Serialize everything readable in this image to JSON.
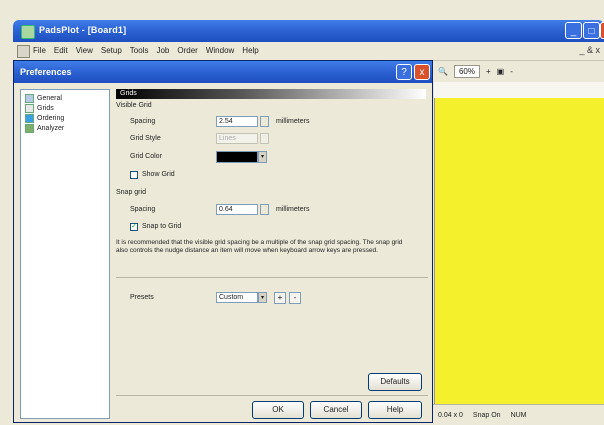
{
  "app": {
    "title": "PadsPlot - [Board1]",
    "menu": [
      "File",
      "Edit",
      "View",
      "Setup",
      "Tools",
      "Job",
      "Order",
      "Window",
      "Help"
    ],
    "mdi_controls": "_ & x",
    "window_buttons": {
      "minimize": "_",
      "maximize": "□",
      "close": "x"
    }
  },
  "toolbar": {
    "zoom": "60%",
    "plus": "+",
    "minus": "-"
  },
  "statusbar": {
    "coords": "0.04 x 0",
    "snap": "Snap On",
    "mode": "NUM"
  },
  "dialog": {
    "title": "Preferences",
    "help_button": "?",
    "close_button": "x",
    "nav_items": [
      {
        "label": "General",
        "icon": "general-icon"
      },
      {
        "label": "Grids",
        "icon": "grids-icon"
      },
      {
        "label": "Ordering",
        "icon": "ordering-icon"
      },
      {
        "label": "Analyzer",
        "icon": "analyzer-icon"
      }
    ],
    "panel_title": "Grids",
    "visible_grid": {
      "heading": "Visible Grid",
      "spacing_label": "Spacing",
      "spacing_value": "2.54",
      "units": "millimeters",
      "grid_style_label": "Grid Style",
      "grid_style_value": "Lines",
      "grid_color_label": "Grid Color",
      "grid_color": "#000000",
      "show_grid_label": "Show Grid",
      "show_grid_checked": false
    },
    "snap_grid": {
      "heading": "Snap grid",
      "spacing_label": "Spacing",
      "spacing_value": "0.64",
      "units": "millimeters",
      "snap_to_grid_label": "Snap to Grid",
      "snap_to_grid_checked": true
    },
    "note": "It is recommended that the visible grid spacing be a multiple of the snap grid spacing. The snap grid also controls the nudge distance an item will move when keyboard arrow keys are pressed.",
    "presets_label": "Presets",
    "presets_value": "Custom",
    "preset_add": "+",
    "preset_remove": "-",
    "defaults_button": "Defaults",
    "ok_button": "OK",
    "cancel_button": "Cancel",
    "help_btn": "Help"
  }
}
